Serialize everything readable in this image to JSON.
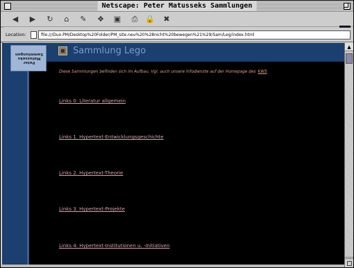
{
  "window": {
    "title": "Netscape: Peter Matusseks Sammlungen"
  },
  "toolbar": {
    "buttons": [
      {
        "name": "back-button",
        "icon": "back-arrow-icon",
        "glyph": "◀"
      },
      {
        "name": "forward-button",
        "icon": "forward-arrow-icon",
        "glyph": "▶"
      },
      {
        "name": "reload-button",
        "icon": "reload-icon",
        "glyph": "↻"
      },
      {
        "name": "home-button",
        "icon": "home-icon",
        "glyph": "⌂"
      },
      {
        "name": "search-button",
        "icon": "search-icon",
        "glyph": "✎"
      },
      {
        "name": "guide-button",
        "icon": "guide-icon",
        "glyph": "❖"
      },
      {
        "name": "images-button",
        "icon": "images-icon",
        "glyph": "▣"
      },
      {
        "name": "print-button",
        "icon": "print-icon",
        "glyph": "⎙"
      },
      {
        "name": "security-button",
        "icon": "lock-icon",
        "glyph": "🔒"
      },
      {
        "name": "stop-button",
        "icon": "stop-icon",
        "glyph": "✖"
      }
    ],
    "logo_glyph": "N"
  },
  "location": {
    "label": "Location:",
    "url": "file:///Duo.PM/Desktop%20Folder/PM_site.neu%20%28nicht%20bewegen%21%29/Sam/Leg/index.html"
  },
  "page": {
    "logo_text": "Peter Matusseks Sammlungen",
    "title": "Sammlung Lego",
    "intro": "Diese Sammlungen befinden sich im Aufbau. Vgl. auch unsere Infodienste auf der Homepage des",
    "intro_link": "KWS",
    "links": [
      "Links 0: Literatur allgemein",
      "Links 1. Hypertext-Entwicklungsgeschichte",
      "Links 2. Hypertext-Theorie",
      "Links 3. Hypertext-Projekte",
      "Links 4: Hypertext-Institutionen u. -Initiativen"
    ]
  },
  "scrollbar": {
    "up_glyph": "▲",
    "down_glyph": "▼"
  },
  "colors": {
    "page_background": "#000000",
    "band_blue": "#1b3f6e",
    "title_blue": "#7e9bd1",
    "link_pink": "#d4a4ae",
    "intro_text": "#d9a08a"
  }
}
